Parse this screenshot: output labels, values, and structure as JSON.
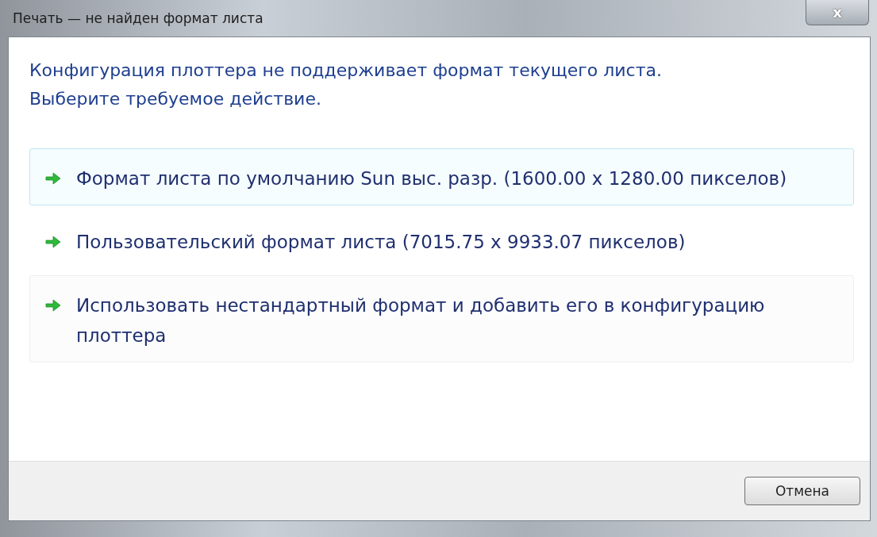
{
  "window": {
    "title": "Печать — не найден формат листа",
    "close": "x"
  },
  "instruction": [
    "Конфигурация плоттера не поддерживает формат текущего листа.",
    "Выберите требуемое действие."
  ],
  "options": [
    {
      "label": "Формат листа по умолчанию Sun выс. разр. (1600.00 x 1280.00 пикселов)",
      "highlighted": true,
      "focused": false
    },
    {
      "label": "Пользовательский формат листа  (7015.75 x 9933.07 пикселов)",
      "highlighted": false,
      "focused": false
    },
    {
      "label": "Использовать нестандартный формат и добавить его в конфигурацию плоттера",
      "highlighted": false,
      "focused": true
    }
  ],
  "buttons": [
    "Отмена"
  ]
}
